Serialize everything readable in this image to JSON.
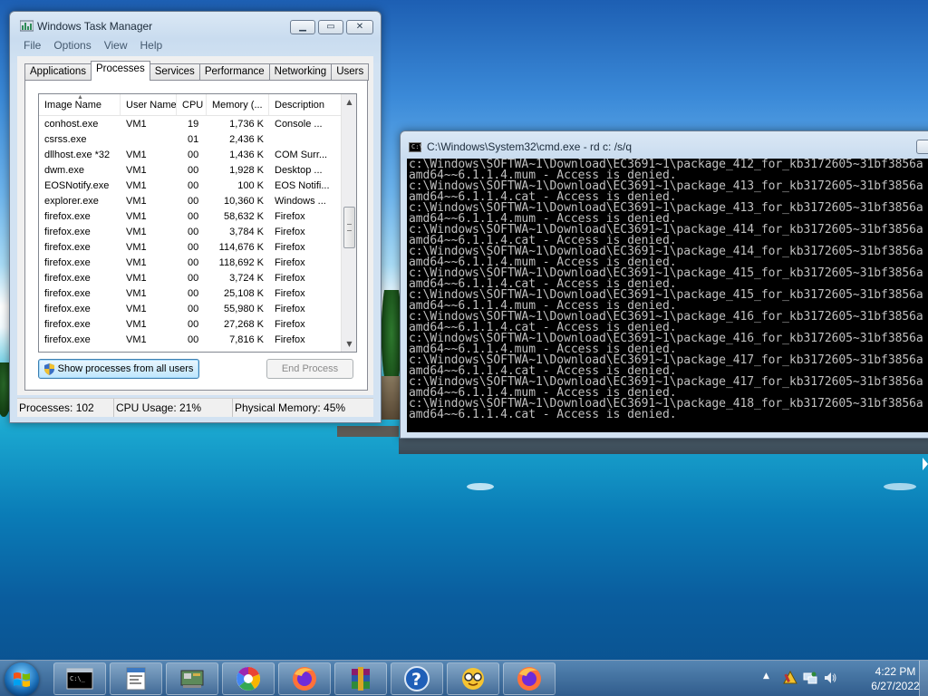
{
  "taskmgr": {
    "title": "Windows Task Manager",
    "menu": [
      "File",
      "Options",
      "View",
      "Help"
    ],
    "tabs": [
      "Applications",
      "Processes",
      "Services",
      "Performance",
      "Networking",
      "Users"
    ],
    "active_tab": "Processes",
    "columns": [
      "Image Name",
      "User Name",
      "CPU",
      "Memory (...",
      "Description"
    ],
    "rows": [
      {
        "image": "conhost.exe",
        "user": "VM1",
        "cpu": "19",
        "mem": "1,736 K",
        "desc": "Console ..."
      },
      {
        "image": "csrss.exe",
        "user": "",
        "cpu": "01",
        "mem": "2,436 K",
        "desc": ""
      },
      {
        "image": "dllhost.exe *32",
        "user": "VM1",
        "cpu": "00",
        "mem": "1,436 K",
        "desc": "COM Surr..."
      },
      {
        "image": "dwm.exe",
        "user": "VM1",
        "cpu": "00",
        "mem": "1,928 K",
        "desc": "Desktop ..."
      },
      {
        "image": "EOSNotify.exe",
        "user": "VM1",
        "cpu": "00",
        "mem": "100 K",
        "desc": "EOS Notifi..."
      },
      {
        "image": "explorer.exe",
        "user": "VM1",
        "cpu": "00",
        "mem": "10,360 K",
        "desc": "Windows ..."
      },
      {
        "image": "firefox.exe",
        "user": "VM1",
        "cpu": "00",
        "mem": "58,632 K",
        "desc": "Firefox"
      },
      {
        "image": "firefox.exe",
        "user": "VM1",
        "cpu": "00",
        "mem": "3,784 K",
        "desc": "Firefox"
      },
      {
        "image": "firefox.exe",
        "user": "VM1",
        "cpu": "00",
        "mem": "114,676 K",
        "desc": "Firefox"
      },
      {
        "image": "firefox.exe",
        "user": "VM1",
        "cpu": "00",
        "mem": "118,692 K",
        "desc": "Firefox"
      },
      {
        "image": "firefox.exe",
        "user": "VM1",
        "cpu": "00",
        "mem": "3,724 K",
        "desc": "Firefox"
      },
      {
        "image": "firefox.exe",
        "user": "VM1",
        "cpu": "00",
        "mem": "25,108 K",
        "desc": "Firefox"
      },
      {
        "image": "firefox.exe",
        "user": "VM1",
        "cpu": "00",
        "mem": "55,980 K",
        "desc": "Firefox"
      },
      {
        "image": "firefox.exe",
        "user": "VM1",
        "cpu": "00",
        "mem": "27,268 K",
        "desc": "Firefox"
      },
      {
        "image": "firefox.exe",
        "user": "VM1",
        "cpu": "00",
        "mem": "7,816 K",
        "desc": "Firefox"
      }
    ],
    "show_all_label": "Show processes from all users",
    "end_process_label": "End Process",
    "status": {
      "processes": "Processes: 102",
      "cpu": "CPU Usage: 21%",
      "memory": "Physical Memory: 45%"
    }
  },
  "cmd": {
    "title": "C:\\Windows\\System32\\cmd.exe - rd  c: /s/q",
    "lines": [
      "c:\\Windows\\SOFTWA~1\\Download\\EC3691~1\\package_412_for_kb3172605~31bf3856a",
      "amd64~~6.1.1.4.mum - Access is denied.",
      "c:\\Windows\\SOFTWA~1\\Download\\EC3691~1\\package_413_for_kb3172605~31bf3856a",
      "amd64~~6.1.1.4.cat - Access is denied.",
      "c:\\Windows\\SOFTWA~1\\Download\\EC3691~1\\package_413_for_kb3172605~31bf3856a",
      "amd64~~6.1.1.4.mum - Access is denied.",
      "c:\\Windows\\SOFTWA~1\\Download\\EC3691~1\\package_414_for_kb3172605~31bf3856a",
      "amd64~~6.1.1.4.cat - Access is denied.",
      "c:\\Windows\\SOFTWA~1\\Download\\EC3691~1\\package_414_for_kb3172605~31bf3856a",
      "amd64~~6.1.1.4.mum - Access is denied.",
      "c:\\Windows\\SOFTWA~1\\Download\\EC3691~1\\package_415_for_kb3172605~31bf3856a",
      "amd64~~6.1.1.4.cat - Access is denied.",
      "c:\\Windows\\SOFTWA~1\\Download\\EC3691~1\\package_415_for_kb3172605~31bf3856a",
      "amd64~~6.1.1.4.mum - Access is denied.",
      "c:\\Windows\\SOFTWA~1\\Download\\EC3691~1\\package_416_for_kb3172605~31bf3856a",
      "amd64~~6.1.1.4.cat - Access is denied.",
      "c:\\Windows\\SOFTWA~1\\Download\\EC3691~1\\package_416_for_kb3172605~31bf3856a",
      "amd64~~6.1.1.4.mum - Access is denied.",
      "c:\\Windows\\SOFTWA~1\\Download\\EC3691~1\\package_417_for_kb3172605~31bf3856a",
      "amd64~~6.1.1.4.cat - Access is denied.",
      "c:\\Windows\\SOFTWA~1\\Download\\EC3691~1\\package_417_for_kb3172605~31bf3856a",
      "amd64~~6.1.1.4.mum - Access is denied.",
      "c:\\Windows\\SOFTWA~1\\Download\\EC3691~1\\package_418_for_kb3172605~31bf3856a",
      "amd64~~6.1.1.4.cat - Access is denied."
    ]
  },
  "taskbar": {
    "buttons": [
      "cmd-icon",
      "notepad-icon",
      "hardware-icon",
      "picasa-icon",
      "firefox-icon",
      "winrar-icon",
      "help-icon",
      "nerd-face-icon",
      "firefox-icon"
    ],
    "clock_time": "4:22 PM",
    "clock_date": "6/27/2022"
  },
  "colors": {
    "console_bg": "#000000",
    "console_fg": "#c0c0c0",
    "selected_button": "#bee6fd"
  }
}
